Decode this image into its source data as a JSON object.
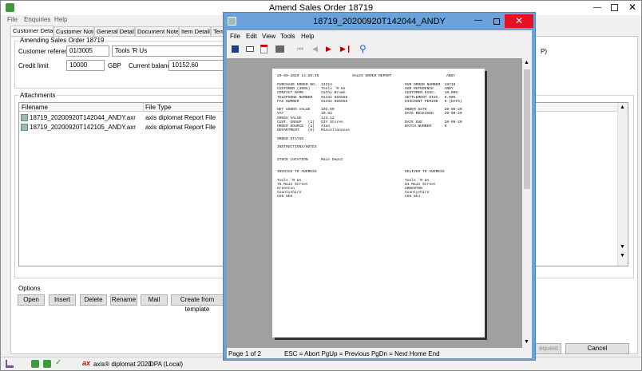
{
  "main_window": {
    "title": "Amend Sales Order 18719",
    "menu": [
      "File",
      "Enquiries",
      "Help"
    ],
    "tabs": [
      "Customer Details",
      "Customer Notes",
      "General Details",
      "Document Notes",
      "Item Details",
      "Tem"
    ],
    "group_title": "Amending Sales Order 18719",
    "customer_reference_label": "Customer reference",
    "customer_reference_value": "01/3005",
    "customer_name_value": "Tools 'R Us",
    "credit_limit_label": "Credit limit",
    "credit_limit_value": "10000",
    "currency": "GBP",
    "current_balance_label": "Current balance",
    "current_balance_value": "10152.60",
    "right_edge_fragment": "P)",
    "attachments_title": "Attachments",
    "columns": [
      "Filename",
      "File Type"
    ],
    "rows": [
      {
        "filename": "18719_20200920T142044_ANDY.axr",
        "filetype": "axis diplomat Report File"
      },
      {
        "filename": "18719_20200920T142105_ANDY.axr",
        "filetype": "axis diplomat Report File"
      }
    ],
    "options_title": "Options",
    "option_buttons": [
      "Open",
      "Insert",
      "Delete",
      "Rename",
      "Mail",
      "Create from template"
    ],
    "request_button_fragment": "equest",
    "cancel_button": "Cancel",
    "status": {
      "app_name": "axis® diplomat 2020",
      "connection": "DPA (Local)"
    }
  },
  "viewer": {
    "title": "18719_20200920T142044_ANDY",
    "menu": [
      "File",
      "Edit",
      "View",
      "Tools",
      "Help"
    ],
    "toolbar_icons": [
      "save-icon",
      "mail-icon",
      "pdf-icon",
      "print-icon",
      "first-page-icon",
      "prev-page-icon",
      "next-page-icon",
      "last-page-icon",
      "zoom-icon"
    ],
    "status_page": "Page 1 of 2",
    "status_help": "ESC = Abort PgUp = Previous PgDn = Next Home End",
    "report": {
      "header_date": "20-09-2020 14:20:45",
      "header_title": "SALES ORDER REPORT",
      "header_user": "ANDY",
      "left_lines": [
        "PURCHASE ORDER NO.  24214",
        "CUSTOMER (3005)     Tools 'R Us",
        "CONTACT NAME        Cathy Brown",
        "TELEPHONE NUMBER    01432 555666",
        "FAX NUMBER          01432 666555",
        "",
        "NET GOODS VALUE     102.60",
        "VAT                 20.52",
        "GROSS VALUE         123.12",
        "CUST. GROUP   (2)   DIY Stores",
        "ORDER SOURCE  (2)   Alan",
        "DEPARTMENT    (0)   Miscellaneous",
        "",
        "ORDER STATUS",
        "",
        "INSTRUCTIONS/NOTES",
        "",
        "",
        "STOCK LOCATION      Main Depot",
        "",
        "",
        "INVOICE TO ADDRESS",
        "",
        "Tools 'R Us",
        "76 Main Street",
        "Greenton",
        "Countyshire",
        "CS6 9GH"
      ],
      "right_lines": [
        "OUR ORDER NUMBER  18719",
        "OUR REFERENCE     ANDY",
        "CUSTOMER DISC.    10.00%",
        "SETTLEMENT DISC.  0.00%",
        "DISCOUNT PERIOD   0 (DAYS)",
        "",
        "ORDER DATE        20-09-20",
        "DATE RECEIVED     20-09-20",
        "",
        "DATE DUE          20-09-20",
        "BATCH NUMBER      0",
        "",
        "",
        "",
        "",
        "",
        "",
        "",
        "",
        "",
        "",
        "DELIVER TO ADDRESS",
        "",
        "Tools 'R Us",
        "84 Main Street",
        "GREENTON",
        "Countyshire",
        "CS6 8GJ"
      ]
    }
  },
  "colors": {
    "title_bar": "#ffffff",
    "viewer_border": "#6aa2d9",
    "close_red": "#e81123",
    "report_bg": "#a0a0a0"
  }
}
